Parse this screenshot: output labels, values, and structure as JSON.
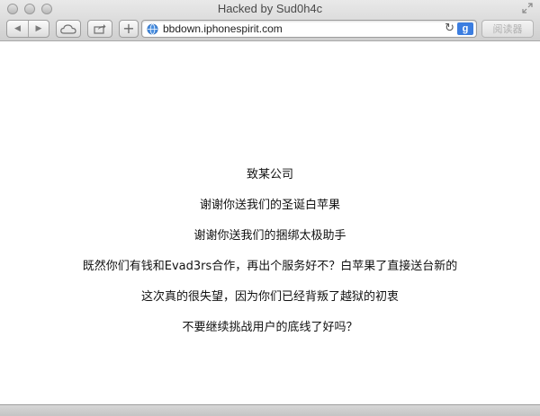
{
  "window": {
    "title": "Hacked by Sud0h4c"
  },
  "toolbar": {
    "back_icon": "back-arrow-icon",
    "forward_icon": "forward-arrow-icon",
    "cloud_icon": "cloud-icon",
    "share_icon": "share-icon",
    "new_tab_label": "+",
    "reader_label": "阅读器"
  },
  "address_bar": {
    "url": "bbdown.iphonespirit.com",
    "search_engine_label": "g"
  },
  "page": {
    "lines": [
      "致某公司",
      "谢谢你送我们的圣诞白苹果",
      "谢谢你送我们的捆绑太极助手",
      "既然你们有钱和Evad3rs合作，再出个服务好不？白苹果了直接送台新的",
      "这次真的很失望，因为你们已经背叛了越狱的初衷",
      "不要继续挑战用户的底线了好吗？"
    ]
  },
  "colors": {
    "search_engine": "#3b7de0",
    "background": "#ffffff"
  }
}
